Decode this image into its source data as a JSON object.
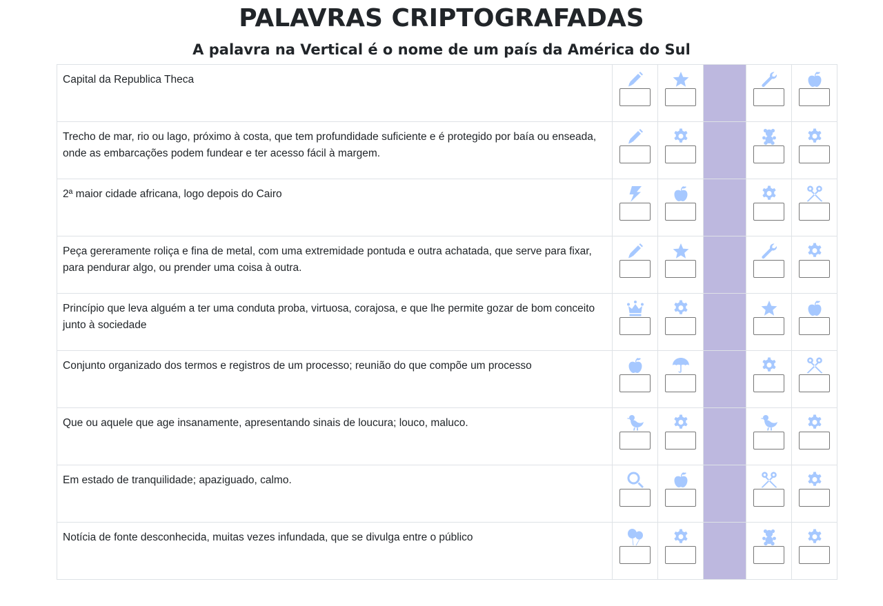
{
  "title": "PALAVRAS CRIPTOGRAFADAS",
  "subtitle": "A palavra na Vertical é o nome de um país da América do Sul",
  "icon_color": "#a6c8ff",
  "highlight_color": "#bdb8df",
  "rows": [
    {
      "clue": "Capital da Republica Theca",
      "icons": [
        "pencil-icon",
        "star-icon",
        "wrench-icon",
        "apple-icon"
      ]
    },
    {
      "clue": "Trecho de mar, rio ou lago, próximo à costa, que tem profundidade suficiente e é protegido por baía ou enseada, onde as embarcações podem fundear e ter acesso fácil à margem.",
      "icons": [
        "pencil-icon",
        "gear-icon",
        "teddy-bear-icon",
        "gear-icon"
      ]
    },
    {
      "clue": "2ª maior cidade africana, logo depois do Cairo",
      "icons": [
        "lightning-icon",
        "apple-icon",
        "gear-icon",
        "scissors-icon"
      ]
    },
    {
      "clue": "Peça gereramente roliça e fina de metal, com uma extremidade pontuda e outra achatada, que serve para fixar, para pendurar algo, ou prender uma coisa à outra.",
      "icons": [
        "pencil-icon",
        "star-icon",
        "wrench-icon",
        "gear-icon"
      ]
    },
    {
      "clue": "Princípio que leva alguém a ter uma conduta proba, virtuosa, corajosa, e que lhe permite gozar de bom conceito junto à sociedade",
      "icons": [
        "crown-icon",
        "gear-icon",
        "star-icon",
        "apple-icon"
      ]
    },
    {
      "clue": "Conjunto organizado dos termos e registros de um processo; reunião do que compõe um processo",
      "icons": [
        "apple-icon",
        "umbrella-icon",
        "gear-icon",
        "scissors-icon"
      ]
    },
    {
      "clue": "Que ou aquele que age insanamente, apresentando sinais de loucura; louco, maluco.",
      "icons": [
        "bird-icon",
        "gear-icon",
        "bird-icon",
        "gear-icon"
      ]
    },
    {
      "clue": "Em estado de tranquilidade; apaziguado, calmo.",
      "icons": [
        "magnifier-icon",
        "apple-icon",
        "scissors-icon",
        "gear-icon"
      ]
    },
    {
      "clue": "Notícia de fonte desconhecida, muitas vezes infundada, que se divulga entre o público",
      "icons": [
        "balloons-icon",
        "gear-icon",
        "teddy-bear-icon",
        "gear-icon"
      ]
    }
  ]
}
